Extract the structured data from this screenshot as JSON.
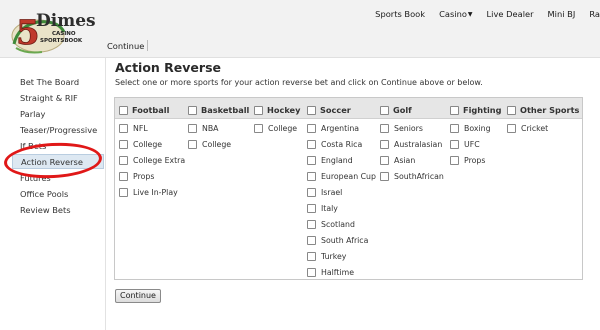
{
  "brand": {
    "number": "5",
    "name": "Dimes",
    "tagline1": "CASINO",
    "tagline2": "SPORTSBOOK"
  },
  "topnav": {
    "sports_book": "Sports Book",
    "casino": "Casino",
    "live_dealer": "Live Dealer",
    "mini_bj": "Mini BJ",
    "cut_off": "Ra"
  },
  "toolbar": {
    "continue": "Continue"
  },
  "sidebar": {
    "items": [
      {
        "label": "Bet The Board"
      },
      {
        "label": "Straight & RIF"
      },
      {
        "label": "Parlay"
      },
      {
        "label": "Teaser/Progressive"
      },
      {
        "label": "If Bets"
      },
      {
        "label": "Action Reverse"
      },
      {
        "label": "Futures"
      },
      {
        "label": "Office Pools"
      },
      {
        "label": "Review Bets"
      }
    ]
  },
  "main": {
    "title": "Action Reverse",
    "subtitle": "Select one or more sports for your action reverse bet and click on Continue above or below.",
    "continue_button": "Continue"
  },
  "sports": [
    {
      "name": "Football",
      "options": [
        "NFL",
        "College",
        "College Extra",
        "Props",
        "Live In-Play"
      ]
    },
    {
      "name": "Basketball",
      "options": [
        "NBA",
        "College"
      ]
    },
    {
      "name": "Hockey",
      "options": [
        "College"
      ]
    },
    {
      "name": "Soccer",
      "options": [
        "Argentina",
        "Costa Rica",
        "England",
        "European Cup",
        "Israel",
        "Italy",
        "Scotland",
        "South Africa",
        "Turkey",
        "Halftime"
      ]
    },
    {
      "name": "Golf",
      "options": [
        "Seniors",
        "Australasian",
        "Asian",
        "SouthAfrican"
      ]
    },
    {
      "name": "Fighting",
      "options": [
        "Boxing",
        "UFC",
        "Props"
      ]
    },
    {
      "name": "Other Sports",
      "options": [
        "Cricket"
      ]
    }
  ],
  "colors": {
    "highlight": "#dde8f2",
    "annotation": "#e01818"
  }
}
